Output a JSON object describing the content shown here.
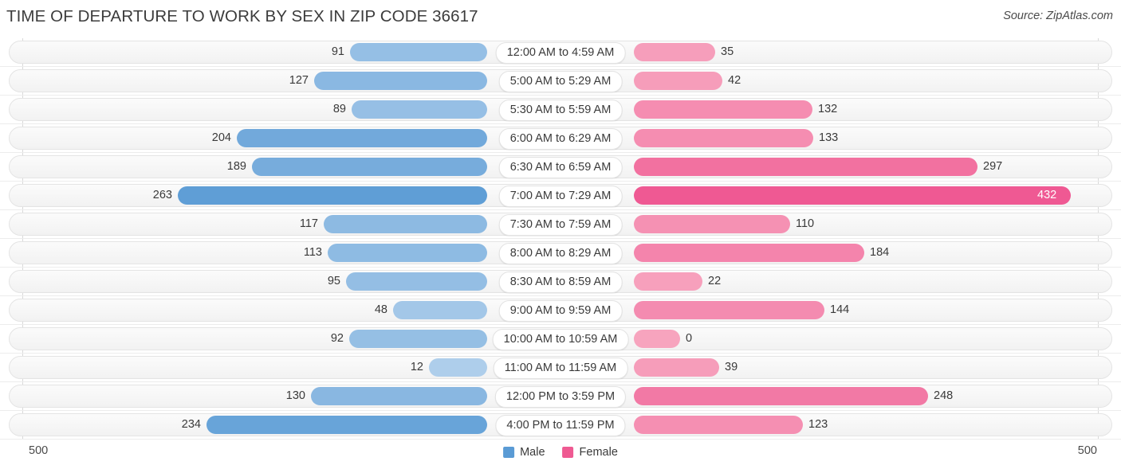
{
  "header": {
    "title": "TIME OF DEPARTURE TO WORK BY SEX IN ZIP CODE 36617",
    "source": "Source: ZipAtlas.com"
  },
  "legend": {
    "male_label": "Male",
    "female_label": "Female",
    "male_color": "#5a9bd5",
    "female_color": "#ef5a92"
  },
  "axis": {
    "left_max": "500",
    "right_max": "500"
  },
  "chart_data": {
    "type": "bar",
    "title": "TIME OF DEPARTURE TO WORK BY SEX IN ZIP CODE 36617",
    "subtitle": "Source: ZipAtlas.com",
    "orientation": "horizontal-diverging",
    "xlabel": "",
    "ylabel": "",
    "xlim": [
      500,
      500
    ],
    "grid": false,
    "legend_position": "bottom-center",
    "categories": [
      "12:00 AM to 4:59 AM",
      "5:00 AM to 5:29 AM",
      "5:30 AM to 5:59 AM",
      "6:00 AM to 6:29 AM",
      "6:30 AM to 6:59 AM",
      "7:00 AM to 7:29 AM",
      "7:30 AM to 7:59 AM",
      "8:00 AM to 8:29 AM",
      "8:30 AM to 8:59 AM",
      "9:00 AM to 9:59 AM",
      "10:00 AM to 10:59 AM",
      "11:00 AM to 11:59 AM",
      "12:00 PM to 3:59 PM",
      "4:00 PM to 11:59 PM"
    ],
    "series": [
      {
        "name": "Male",
        "color": "#5a9bd5",
        "values": [
          91,
          127,
          89,
          204,
          189,
          263,
          117,
          113,
          95,
          48,
          92,
          12,
          130,
          234
        ]
      },
      {
        "name": "Female",
        "color": "#ef5a92",
        "values": [
          35,
          42,
          132,
          133,
          297,
          432,
          110,
          184,
          22,
          144,
          0,
          39,
          248,
          123
        ]
      }
    ]
  }
}
